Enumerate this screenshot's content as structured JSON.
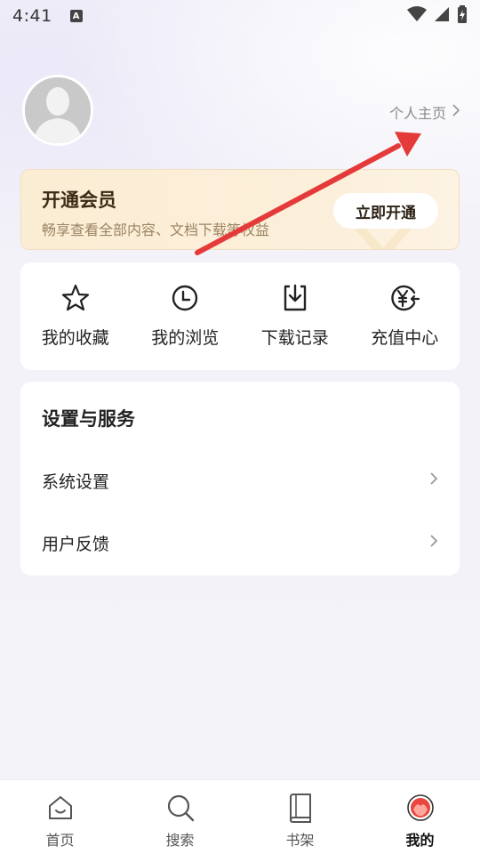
{
  "status_bar": {
    "time": "4:41",
    "notification_letter": "A"
  },
  "profile": {
    "link_label": "个人主页"
  },
  "vip": {
    "title": "开通会员",
    "subtitle": "畅享查看全部内容、文档下载等权益",
    "button_label": "立即开通"
  },
  "actions": [
    {
      "label": "我的收藏",
      "icon": "star-icon"
    },
    {
      "label": "我的浏览",
      "icon": "clock-icon"
    },
    {
      "label": "下载记录",
      "icon": "download-icon"
    },
    {
      "label": "充值中心",
      "icon": "yen-icon"
    }
  ],
  "settings": {
    "title": "设置与服务",
    "rows": [
      {
        "label": "系统设置"
      },
      {
        "label": "用户反馈"
      }
    ]
  },
  "bottom_nav": [
    {
      "label": "首页",
      "icon": "home-icon",
      "active": false
    },
    {
      "label": "搜索",
      "icon": "search-icon",
      "active": false
    },
    {
      "label": "书架",
      "icon": "book-icon",
      "active": false
    },
    {
      "label": "我的",
      "icon": "profile-icon",
      "active": true
    }
  ],
  "colors": {
    "annotation_arrow": "#e53a3a",
    "vip_bg": "#fbedd4",
    "active_nav_accent": "#e8463f"
  }
}
